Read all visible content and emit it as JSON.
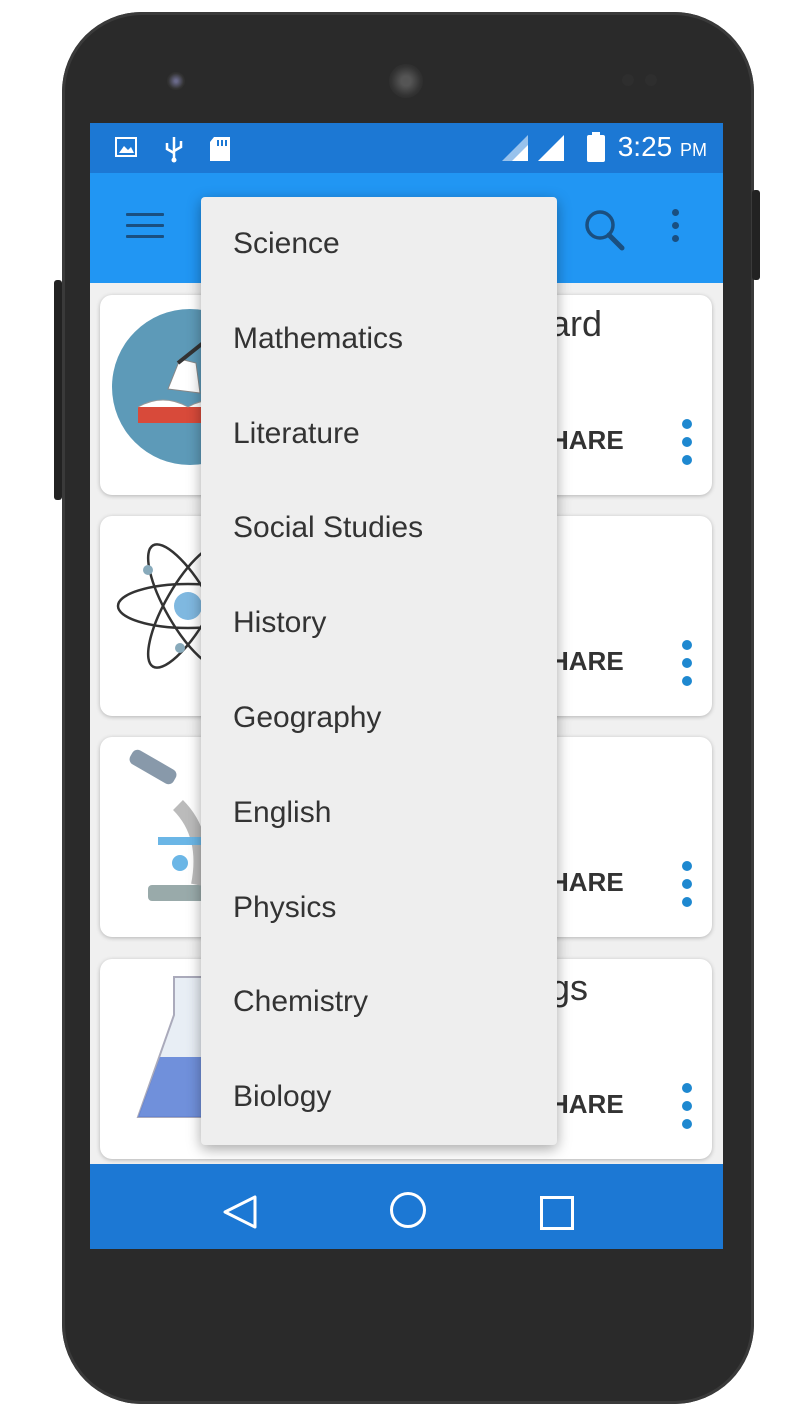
{
  "status_bar": {
    "time": "3:25",
    "ampm": "PM",
    "icons": [
      "image-icon",
      "usb-icon",
      "sd-card-icon",
      "signal-icon",
      "signal-icon",
      "battery-icon"
    ]
  },
  "app_bar": {
    "menu_icon": "hamburger-icon",
    "search_icon": "search-icon",
    "overflow_icon": "more-vert-icon"
  },
  "cards": [
    {
      "title_visible": "ard",
      "share_visible": "HARE",
      "image": "magic-book-illustration"
    },
    {
      "title_visible": "",
      "share_visible": "HARE",
      "image": "atom-illustration"
    },
    {
      "title_visible": "",
      "share_visible": "HARE",
      "image": "microscope-illustration"
    },
    {
      "title_visible": "gs",
      "share_visible": "HARE",
      "image": "flask-illustration"
    }
  ],
  "dropdown": {
    "items": [
      "Science",
      "Mathematics",
      "Literature",
      "Social Studies",
      "History",
      "Geography",
      "English",
      "Physics",
      "Chemistry",
      "Biology"
    ]
  },
  "nav_bar": {
    "back_icon": "back-icon",
    "home_icon": "home-icon",
    "recents_icon": "recents-icon"
  },
  "colors": {
    "status_bar": "#1c78d4",
    "app_bar": "#2196f3",
    "accent": "#1e88d0",
    "dropdown_bg": "#eeeeee"
  }
}
